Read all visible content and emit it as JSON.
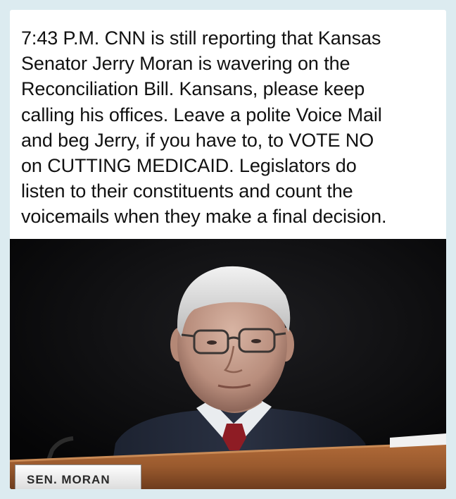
{
  "post": {
    "lines": [
      "7:43 P.M.  CNN is still reporting that Kansas",
      "Senator Jerry Moran is wavering on the",
      "Reconciliation Bill.  Kansans, please keep",
      "calling his offices.  Leave a polite Voice Mail",
      "and beg Jerry, if you have to, to VOTE NO",
      "on CUTTING MEDICAID.   Legislators do",
      "listen to their constituents and count the",
      "voicemails when they make a final decision."
    ]
  },
  "photo": {
    "nameplate_text": "SEN. MORAN"
  },
  "colors": {
    "page_background": "#dcebf0",
    "card_background": "#ffffff",
    "text": "#111111",
    "photo_background": "#0b0b0c",
    "desk": "#9a5a2e"
  }
}
